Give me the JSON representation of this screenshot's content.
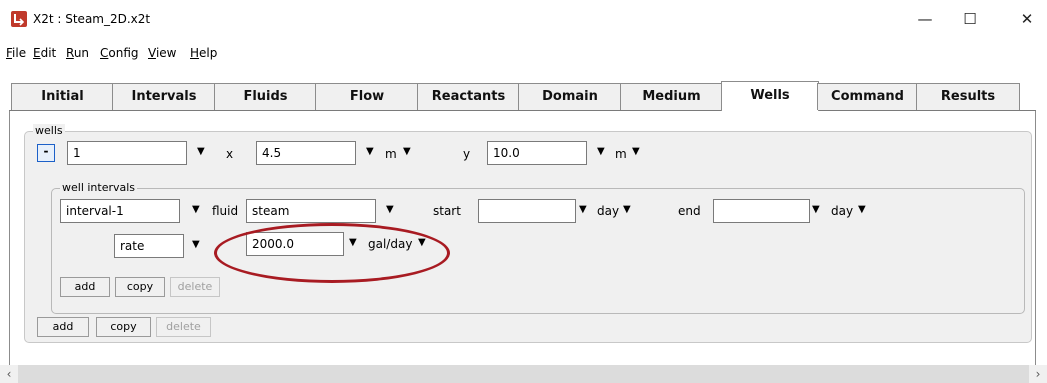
{
  "window": {
    "title": "X2t : Steam_2D.x2t",
    "minimize_glyph": "—",
    "maximize_glyph": "☐",
    "close_glyph": "✕",
    "app_icon": "x2t-app-icon",
    "icon_color": "#c0392b"
  },
  "menu": [
    {
      "pre": "",
      "u": "F",
      "post": "ile"
    },
    {
      "pre": "",
      "u": "E",
      "post": "dit"
    },
    {
      "pre": "",
      "u": "R",
      "post": "un"
    },
    {
      "pre": "",
      "u": "C",
      "post": "onfig"
    },
    {
      "pre": "",
      "u": "V",
      "post": "iew"
    },
    {
      "pre": "",
      "u": "H",
      "post": "elp"
    }
  ],
  "tabs": [
    "Initial",
    "Intervals",
    "Fluids",
    "Flow",
    "Reactants",
    "Domain",
    "Medium",
    "Wells",
    "Command",
    "Results"
  ],
  "active_tab": "Wells",
  "wells": {
    "group_label": "wells",
    "collapse_glyph": "-",
    "well_name": "1",
    "x_label": "x",
    "x_value": "4.5",
    "x_unit": "m",
    "y_label": "y",
    "y_value": "10.0",
    "y_unit": "m",
    "intervals": {
      "group_label": "well intervals",
      "interval_name": "interval-1",
      "fluid_label": "fluid",
      "fluid_value": "steam",
      "start_label": "start",
      "start_value": "",
      "start_unit": "day",
      "end_label": "end",
      "end_value": "",
      "end_unit": "day",
      "rate_type": "rate",
      "rate_value": "2000.0",
      "rate_unit": "gal/day",
      "buttons": {
        "add": "add",
        "copy": "copy",
        "delete": "delete"
      }
    },
    "buttons": {
      "add": "add",
      "copy": "copy",
      "delete": "delete"
    }
  },
  "colors": {
    "highlight": "#a81b22",
    "collapse_border": "#1c60c8"
  }
}
